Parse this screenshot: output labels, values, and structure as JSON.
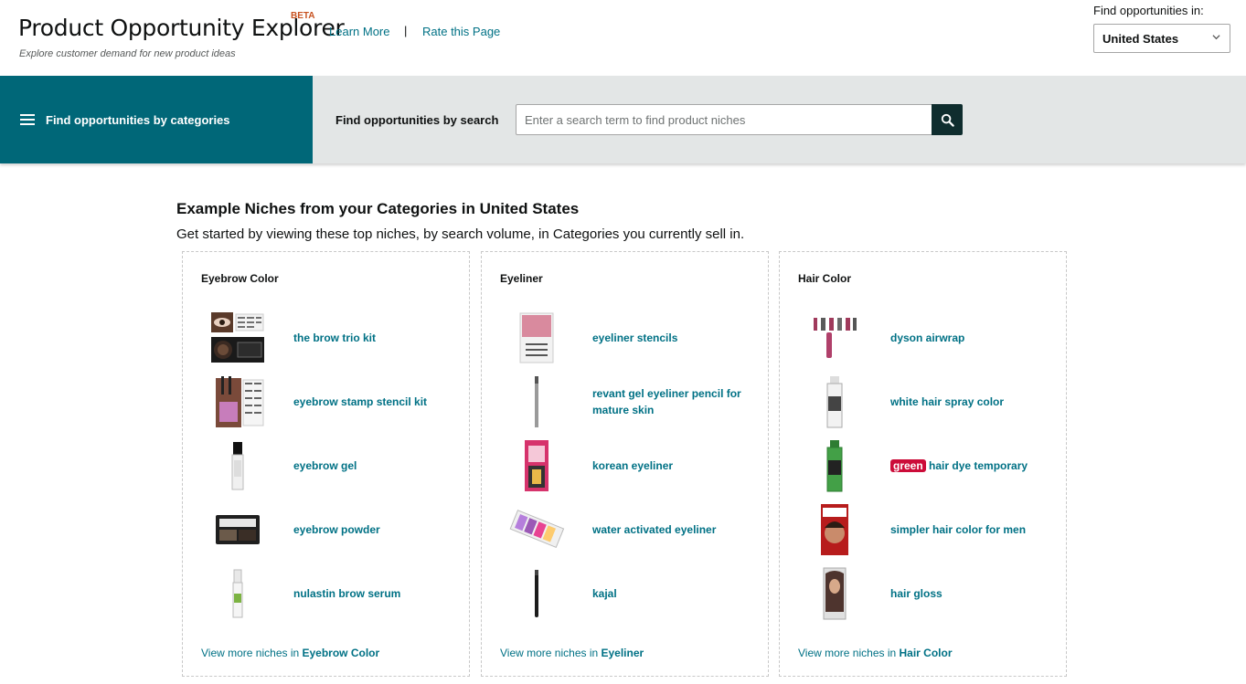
{
  "header": {
    "title": "Product Opportunity Explorer",
    "beta": "BETA",
    "learn_more": "Learn More",
    "separator": "|",
    "rate_page": "Rate this Page",
    "subtitle": "Explore customer demand for new product ideas",
    "find_in_label": "Find opportunities in:",
    "country": "United States"
  },
  "nav": {
    "categories_label": "Find opportunities by categories",
    "search_label": "Find opportunities by search",
    "search_placeholder": "Enter a search term to find product niches"
  },
  "main": {
    "title": "Example Niches from your Categories in United States",
    "description": "Get started by viewing these top niches, by search volume, in Categories you currently sell in.",
    "view_more_prefix": "View more niches in ",
    "cards": [
      {
        "title": "Eyebrow Color",
        "niches": [
          "the brow trio kit",
          "eyebrow stamp stencil kit",
          "eyebrow gel",
          "eyebrow powder",
          "nulastin brow serum"
        ]
      },
      {
        "title": "Eyeliner",
        "niches": [
          "eyeliner stencils",
          "revant gel eyeliner pencil for mature skin",
          "korean eyeliner",
          "water activated eyeliner",
          "kajal"
        ]
      },
      {
        "title": "Hair Color",
        "niches": [
          "dyson airwrap",
          "white hair spray color",
          "hair dye temporary",
          "simpler hair color for men",
          "hair gloss"
        ],
        "highlight_word": "green"
      }
    ]
  },
  "colors": {
    "teal_panel": "#006778",
    "link": "#007185",
    "nav_bg": "#e3e6e6",
    "search_button": "#0f2d2e",
    "highlight": "#cc0c39"
  }
}
